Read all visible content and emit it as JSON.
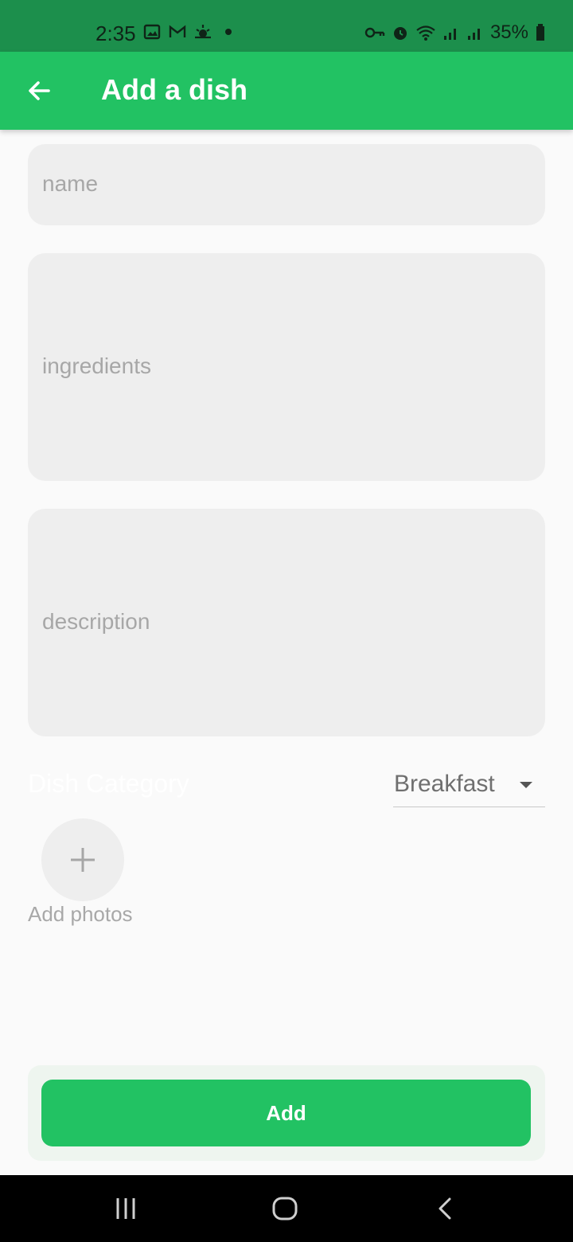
{
  "status_bar": {
    "time": "2:35",
    "battery": "35%",
    "left_icons": [
      "image-icon",
      "gmail-icon",
      "weather-icon",
      "dot-icon"
    ],
    "right_icons": [
      "key-icon",
      "alarm-icon",
      "wifi-icon",
      "signal-icon",
      "signal-icon",
      "battery-icon"
    ]
  },
  "app_bar": {
    "title": "Add a dish",
    "back_icon": "arrow-left-icon"
  },
  "form": {
    "name_placeholder": "name",
    "ingredients_placeholder": "ingredients",
    "description_placeholder": "description",
    "category_label": "Dish Category",
    "category_value": "Breakfast",
    "add_photos_label": "Add photos"
  },
  "actions": {
    "add_label": "Add"
  },
  "colors": {
    "primary": "#22c263",
    "status_bar": "#1c8f4c",
    "field_bg": "#eeeeee",
    "page_bg": "#fafafa"
  }
}
